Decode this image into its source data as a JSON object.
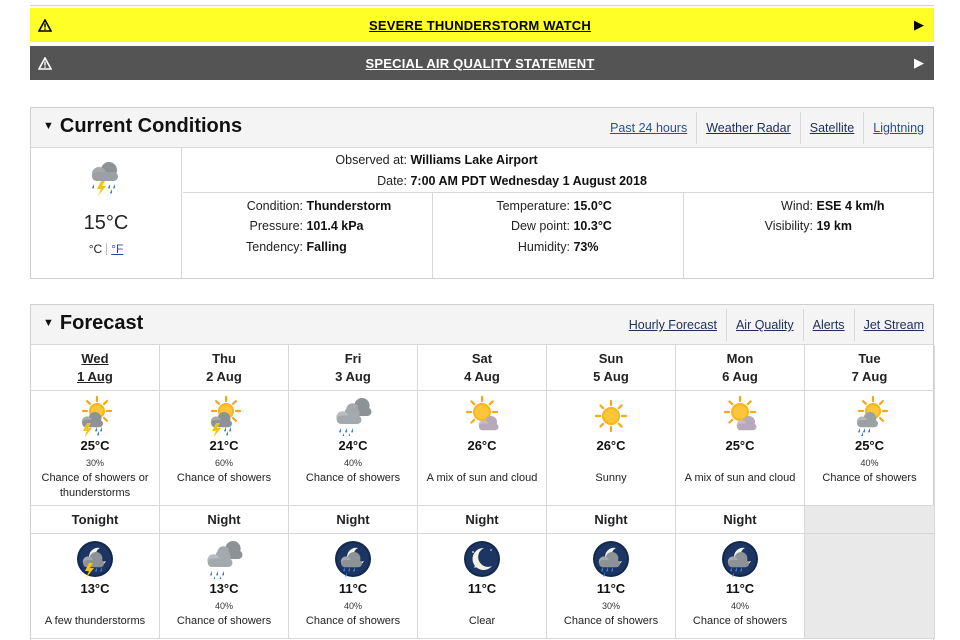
{
  "alerts": [
    {
      "label": "SEVERE THUNDERSTORM WATCH",
      "bg": "#ffff27"
    },
    {
      "label": "SPECIAL AIR QUALITY STATEMENT",
      "bg": "#545454"
    }
  ],
  "current": {
    "title": "Current Conditions",
    "links": [
      "Past 24 hours",
      "Weather Radar",
      "Satellite",
      "Lightning"
    ],
    "temp": "15°C",
    "unit_c": "°C",
    "unit_f": "°F",
    "observed_label": "Observed at:",
    "observed_value": "Williams Lake Airport",
    "date_label": "Date:",
    "date_value": "7:00 AM PDT Wednesday 1 August 2018",
    "condition_label": "Condition:",
    "condition_value": "Thunderstorm",
    "pressure_label": "Pressure:",
    "pressure_value": "101.4 kPa",
    "tendency_label": "Tendency:",
    "tendency_value": "Falling",
    "temperature_label": "Temperature:",
    "temperature_value": "15.0°C",
    "dewpoint_label": "Dew point:",
    "dewpoint_value": "10.3°C",
    "humidity_label": "Humidity:",
    "humidity_value": "73%",
    "wind_label": "Wind:",
    "wind_value": "ESE 4 km/h",
    "visibility_label": "Visibility:",
    "visibility_value": "19 km",
    "icon": "thunder-shower-icon"
  },
  "forecast": {
    "title": "Forecast",
    "links": [
      "Hourly Forecast",
      "Air Quality",
      "Alerts",
      "Jet Stream"
    ],
    "days": [
      {
        "day": "Wed",
        "date": "1 Aug",
        "icon": "sun-thunder-icon",
        "temp": "25°C",
        "pop": "30%",
        "summary": "Chance of showers or thunderstorms"
      },
      {
        "day": "Thu",
        "date": "2 Aug",
        "icon": "sun-thunder-icon",
        "temp": "21°C",
        "pop": "60%",
        "summary": "Chance of showers"
      },
      {
        "day": "Fri",
        "date": "3 Aug",
        "icon": "cloud-rain-icon",
        "temp": "24°C",
        "pop": "40%",
        "summary": "Chance of showers"
      },
      {
        "day": "Sat",
        "date": "4 Aug",
        "icon": "sun-cloud-icon",
        "temp": "26°C",
        "pop": "",
        "summary": "A mix of sun and cloud"
      },
      {
        "day": "Sun",
        "date": "5 Aug",
        "icon": "sun-icon",
        "temp": "26°C",
        "pop": "",
        "summary": "Sunny"
      },
      {
        "day": "Mon",
        "date": "6 Aug",
        "icon": "sun-cloud-icon",
        "temp": "25°C",
        "pop": "",
        "summary": "A mix of sun and cloud"
      },
      {
        "day": "Tue",
        "date": "7 Aug",
        "icon": "sun-rain-icon",
        "temp": "25°C",
        "pop": "40%",
        "summary": "Chance of showers"
      }
    ],
    "nights": [
      {
        "label": "Tonight",
        "icon": "moon-thunder-icon",
        "temp": "13°C",
        "pop": "",
        "summary": "A few thunderstorms"
      },
      {
        "label": "Night",
        "icon": "cloud-rain-icon",
        "temp": "13°C",
        "pop": "40%",
        "summary": "Chance of showers"
      },
      {
        "label": "Night",
        "icon": "moon-rain-icon",
        "temp": "11°C",
        "pop": "40%",
        "summary": "Chance of showers"
      },
      {
        "label": "Night",
        "icon": "moon-clear-icon",
        "temp": "11°C",
        "pop": "",
        "summary": "Clear"
      },
      {
        "label": "Night",
        "icon": "moon-rain-icon",
        "temp": "11°C",
        "pop": "30%",
        "summary": "Chance of showers"
      },
      {
        "label": "Night",
        "icon": "moon-rain-icon",
        "temp": "11°C",
        "pop": "40%",
        "summary": "Chance of showers"
      }
    ]
  }
}
